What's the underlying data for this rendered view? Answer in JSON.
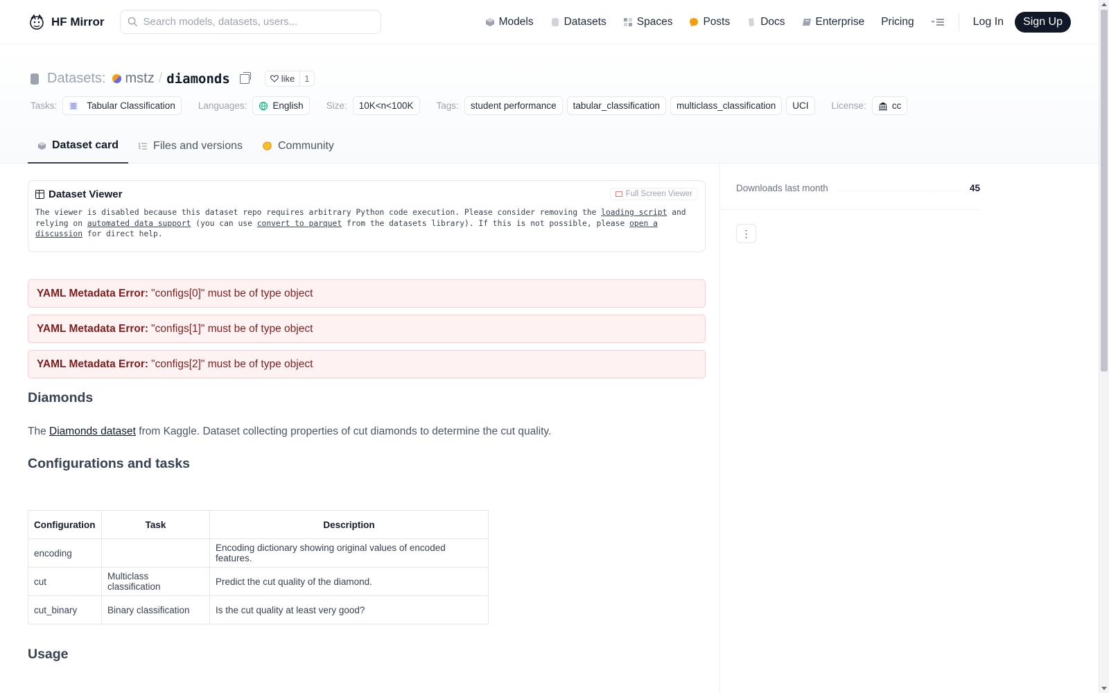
{
  "nav": {
    "brand": "HF Mirror",
    "search_placeholder": "Search models, datasets, users...",
    "links": [
      "Models",
      "Datasets",
      "Spaces",
      "Posts",
      "Docs",
      "Enterprise",
      "Pricing"
    ],
    "login": "Log In",
    "signup": "Sign Up"
  },
  "header": {
    "section": "Datasets:",
    "user": "mstz",
    "slash": "/",
    "repo": "diamonds",
    "like_label": "like",
    "like_count": "1",
    "tasks_label": "Tasks:",
    "task": "Tabular Classification",
    "languages_label": "Languages:",
    "language": "English",
    "size_label": "Size:",
    "size": "10K<n<100K",
    "tags_label": "Tags:",
    "tags": [
      "student performance",
      "tabular_classification",
      "multiclass_classification",
      "UCI"
    ],
    "license_label": "License:",
    "license": "cc"
  },
  "tabs": [
    "Dataset card",
    "Files and versions",
    "Community"
  ],
  "viewer": {
    "title": "Dataset Viewer",
    "fullscreen": "Full Screen Viewer",
    "msg_1": "The viewer is disabled because this dataset repo requires arbitrary Python code execution. Please consider removing the",
    "link_loading": "loading script",
    "msg_2": "and relying on",
    "link_automated": "automated data support",
    "msg_3": "(you can use",
    "link_parquet": "convert to parquet",
    "msg_4": "from the datasets library). If this is not possible, please",
    "link_discussion": "open a discussion",
    "msg_5": "for direct help."
  },
  "errors": {
    "prefix": "YAML Metadata Error:",
    "items": [
      "\"configs[0]\" must be of type object",
      "\"configs[1]\" must be of type object",
      "\"configs[2]\" must be of type object"
    ]
  },
  "content": {
    "h_diamonds": "Diamonds",
    "p_the": "The",
    "p_link": "Diamonds dataset",
    "p_rest": "from Kaggle. Dataset collecting properties of cut diamonds to determine the cut quality.",
    "h_config": "Configurations and tasks",
    "table_headers": [
      "Configuration",
      "Task",
      "Description"
    ],
    "table_rows": [
      [
        "encoding",
        "",
        "Encoding dictionary showing original values of encoded features."
      ],
      [
        "cut",
        "Multiclass classification",
        "Predict the cut quality of the diamond."
      ],
      [
        "cut_binary",
        "Binary classification",
        "Is the cut quality at least very good?"
      ]
    ],
    "h_usage": "Usage"
  },
  "sidebar": {
    "downloads_label": "Downloads last month",
    "downloads_count": "45",
    "menu": "⋮"
  },
  "colors": {
    "accent_dark": "#111827",
    "error_bg": "#fef2f2",
    "error_text": "#7f1d1d"
  }
}
